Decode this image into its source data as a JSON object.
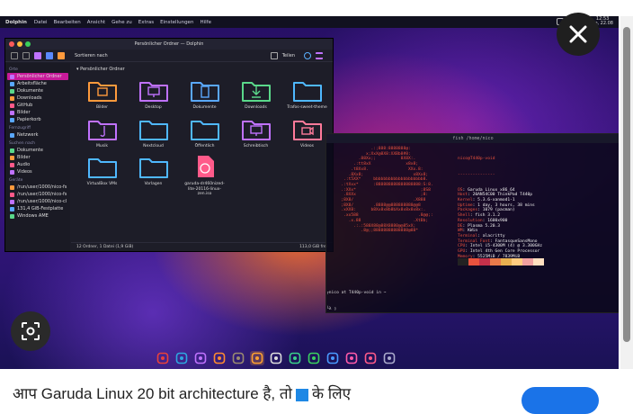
{
  "panel": {
    "app_name": "Dolphin",
    "menu": [
      "Datei",
      "Bearbeiten",
      "Ansicht",
      "Gehe zu",
      "Extras",
      "Einstellungen",
      "Hilfe"
    ],
    "clock_time": "12:53",
    "clock_date": "So, 22.08"
  },
  "dolphin": {
    "title": "Persönlicher Ordner — Dolphin",
    "sort_label": "Sortieren nach",
    "split_label": "Teilen",
    "breadcrumb": "Persönlicher Ordner",
    "sidebar": [
      {
        "group": "Orte",
        "items": [
          "Persönlicher Ordner",
          "Arbeitsfläche",
          "Dokumente",
          "Downloads",
          "GitHub",
          "Bilder",
          "Papierkorb"
        ]
      },
      {
        "group": "Fernzugriff",
        "items": [
          "Netzwerk"
        ]
      },
      {
        "group": "Suchen nach",
        "items": [
          "Dokumente",
          "Bilder",
          "Audio",
          "Videos"
        ]
      },
      {
        "group": "Geräte",
        "items": [
          "/run/user/1000/nico-fs",
          "/run/user/1000/nico-fs",
          "/run/user/1000/nico-cl",
          "131,4 GiB-Festplatte",
          "Windows AME"
        ]
      }
    ],
    "files": [
      {
        "name": "Bilder",
        "color": "#ff9a3c",
        "glyph": "img"
      },
      {
        "name": "Desktop",
        "color": "#c072ff",
        "glyph": "desk"
      },
      {
        "name": "Dokumente",
        "color": "#5aa8ff",
        "glyph": "doc"
      },
      {
        "name": "Downloads",
        "color": "#5ad88a",
        "glyph": "down"
      },
      {
        "name": "Trafos-sweet-theme",
        "color": "#4fb8ff",
        "glyph": ""
      },
      {
        "name": "Musik",
        "color": "#c072ff",
        "glyph": "music"
      },
      {
        "name": "Nextcloud",
        "color": "#4fb8ff",
        "glyph": ""
      },
      {
        "name": "Öffentlich",
        "color": "#4fb8ff",
        "glyph": ""
      },
      {
        "name": "Schreibtisch",
        "color": "#c072ff",
        "glyph": "desk"
      },
      {
        "name": "Videos",
        "color": "#ff7a9a",
        "glyph": "video"
      },
      {
        "name": "VirtualBox VMs",
        "color": "#4fb8ff",
        "glyph": ""
      },
      {
        "name": "Vorlagen",
        "color": "#4fb8ff",
        "glyph": ""
      },
      {
        "name": "garuda-dr460nized-lite-20116-linux-zen.iso",
        "color": "#ff5a8a",
        "glyph": "iso"
      }
    ],
    "status_left": "12 Ordner, 1 Datei (1,9 GiB)",
    "status_right": "113,0 GiB frei"
  },
  "terminal": {
    "title": "fish /home/nico",
    "ascii": "               .:;888:8888888@:\n             x;XxX@8X8:XXBb8#8:\n          .88Xx;;          8X8X:.\n        .:tt8xX              x8x8;\n       .t8Xx8.                XXx.8:\n      .8Xx8;                    x8Xx8;\n    .:t5XX*     bbbbbbbbbbbbbbbbbbbb8.\n   .:tXxx*      :888888888888888888:S:8.\n   .:XXx*                          ;8S8\n    .8XXx                          ;8:\n   ;8X8/                        .X888\n   ;8X8/        .8888@@888888888@@8\n   .xXX8:      b8Xx8x8b8bXx8x8x8x8x:.\n    .xx588                        .8@@;:\n      .x.88                     .XtBb;\n        .:.:588X88@88X8880@@85xX;\n           .8@;;88888888888888@88*",
    "user_host": "nico@T440p-void",
    "info": [
      {
        "k": "OS",
        "v": "Garuda Linux x86_64"
      },
      {
        "k": "Host",
        "v": "20AN54C00 ThinkPad T440p"
      },
      {
        "k": "Kernel",
        "v": "5.3.6-xanmod1-1"
      },
      {
        "k": "Uptime",
        "v": "1 day, 3 hours, 38 mins"
      },
      {
        "k": "Packages",
        "v": "1079 (pacman)"
      },
      {
        "k": "Shell",
        "v": "fish 3.1.2"
      },
      {
        "k": "Resolution",
        "v": "1600x900"
      },
      {
        "k": "DE",
        "v": "Plasma 5.20.3"
      },
      {
        "k": "WM",
        "v": "KWin"
      },
      {
        "k": "Terminal",
        "v": "alacritty"
      },
      {
        "k": "Terminal Font",
        "v": "FantasqueSansMono"
      },
      {
        "k": "CPU",
        "v": "Intel i5-4300M (4) @ 3.300GHz"
      },
      {
        "k": "GPU",
        "v": "Intel 4th Gen Core Processor"
      },
      {
        "k": "Memory",
        "v": "5525MiB / 7839MiB"
      }
    ],
    "swatches": [
      "#222222",
      "#e8523e",
      "#c4304a",
      "#e87a4a",
      "#e8b050",
      "#ffcc80",
      "#f0a0a0",
      "#ffe0c0"
    ],
    "prompt_line1": "┌nico at T440p-void in ~",
    "prompt_line2": "└λ ▯"
  },
  "dock": [
    {
      "name": "garuda",
      "color": "#e8413a"
    },
    {
      "name": "telegram",
      "color": "#2ea6e0"
    },
    {
      "name": "terminal",
      "color": "#c072ff"
    },
    {
      "name": "firefox",
      "color": "#ff8a30"
    },
    {
      "name": "gimp",
      "color": "#9a8a70"
    },
    {
      "name": "files",
      "color": "#ffa030"
    },
    {
      "name": "github",
      "color": "#dddddd"
    },
    {
      "name": "krita",
      "color": "#3ad08a"
    },
    {
      "name": "spotify",
      "color": "#3ad060"
    },
    {
      "name": "monitor",
      "color": "#4a9aff"
    },
    {
      "name": "calendar",
      "color": "#ff5aaa"
    },
    {
      "name": "store",
      "color": "#ff5a8a"
    },
    {
      "name": "power",
      "color": "#aaaacc"
    }
  ],
  "caption": {
    "text_before": "आप Garuda Linux 20 bit architecture है, तो",
    "text_after": "के लिए"
  }
}
